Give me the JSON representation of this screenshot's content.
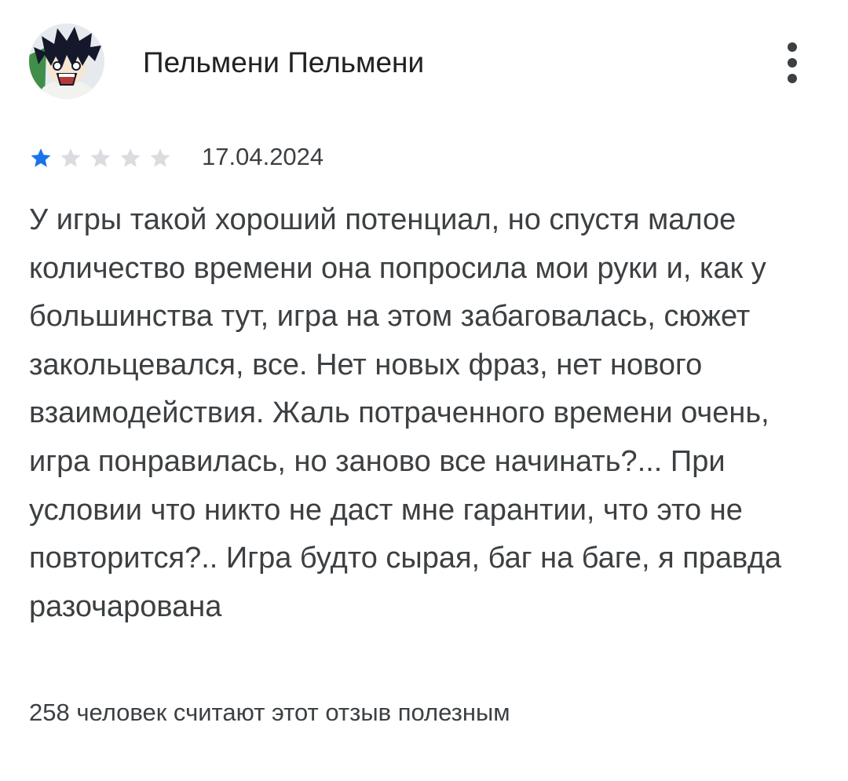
{
  "review": {
    "author": {
      "name": "Пельмени Пельмени",
      "avatar_icon": "anime-character-avatar"
    },
    "menu_icon": "more-vertical-icon",
    "rating": {
      "value": 1,
      "max": 5,
      "filled_color": "#1a73e8",
      "empty_color": "#dadce0"
    },
    "date": "17.04.2024",
    "text": "У игры такой хороший потенциал, но спустя малое количество времени она попросила мои руки и, как у большинства тут, игра на этом забаговалась, сюжет закольцевался, все. Нет новых фраз, нет нового взаимодействия. Жаль потраченного времени очень, игра понравилась, но заново все начинать?... При условии что никто не даст мне гарантии, что это не повторится?.. Игра будто сырая, баг на баге, я правда разочарована",
    "helpful": "258 человек считают этот отзыв полезным"
  }
}
